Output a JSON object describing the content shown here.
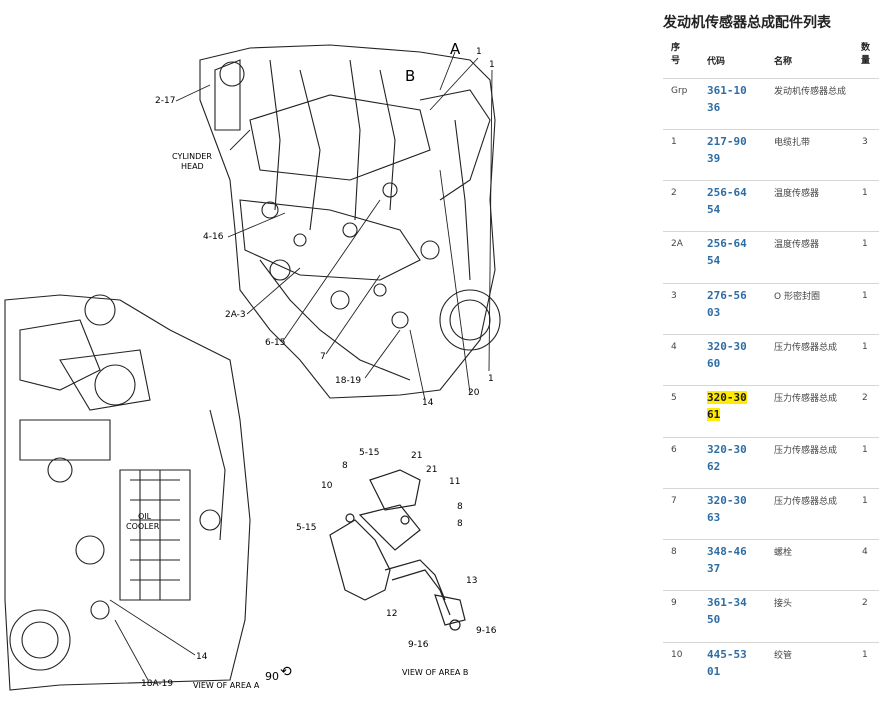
{
  "panel": {
    "title": "发动机传感器总成配件列表",
    "headers": {
      "no": "序号",
      "code": "代码",
      "name": "名称",
      "qty": "数量"
    },
    "rows": [
      {
        "no": "Grp",
        "code": "361-1036",
        "name": "发动机传感器总成",
        "qty": ""
      },
      {
        "no": "1",
        "code": "217-9039",
        "name": "电缆扎带",
        "qty": "3"
      },
      {
        "no": "2",
        "code": "256-6454",
        "name": "温度传感器",
        "qty": "1"
      },
      {
        "no": "2A",
        "code": "256-6454",
        "name": "温度传感器",
        "qty": "1"
      },
      {
        "no": "3",
        "code": "276-5603",
        "name": "O 形密封圈",
        "qty": "1"
      },
      {
        "no": "4",
        "code": "320-3060",
        "name": "压力传感器总成",
        "qty": "1"
      },
      {
        "no": "5",
        "code": "320-3061",
        "name": "压力传感器总成",
        "qty": "2",
        "highlighted": true
      },
      {
        "no": "6",
        "code": "320-3062",
        "name": "压力传感器总成",
        "qty": "1"
      },
      {
        "no": "7",
        "code": "320-3063",
        "name": "压力传感器总成",
        "qty": "1"
      },
      {
        "no": "8",
        "code": "348-4637",
        "name": "螺栓",
        "qty": "4"
      },
      {
        "no": "9",
        "code": "361-3450",
        "name": "接头",
        "qty": "2"
      },
      {
        "no": "10",
        "code": "445-5301",
        "name": "绞管",
        "qty": "1"
      }
    ]
  },
  "diagram": {
    "labels": {
      "a": "A",
      "b": "B",
      "l1a": "1",
      "l1b": "1",
      "l1c": "1",
      "l217": "2-17",
      "cyl1": "CYLINDER",
      "cyl2": "HEAD",
      "l416": "4-16",
      "l2a3": "2A-3",
      "l615": "6-15",
      "l7": "7",
      "l1819": "18-19",
      "l14a": "14",
      "l20": "20",
      "oil1": "OIL",
      "oil2": "COOLER",
      "l14b": "14",
      "l18a19": "18A-19",
      "viewa": "VIEW OF AREA A",
      "l90": "90",
      "viewb": "VIEW OF AREA B",
      "b515a": "5-15",
      "b8a": "8",
      "b21a": "21",
      "b21b": "21",
      "b11": "11",
      "b10": "10",
      "b8b": "8",
      "b8c": "8",
      "b515b": "5-15",
      "b13": "13",
      "b12": "12",
      "b916a": "9-16",
      "b916b": "9-16"
    }
  },
  "colors": {
    "link": "#2e6da4",
    "highlight": "#ffeb00",
    "rule": "#d6d6d6"
  }
}
